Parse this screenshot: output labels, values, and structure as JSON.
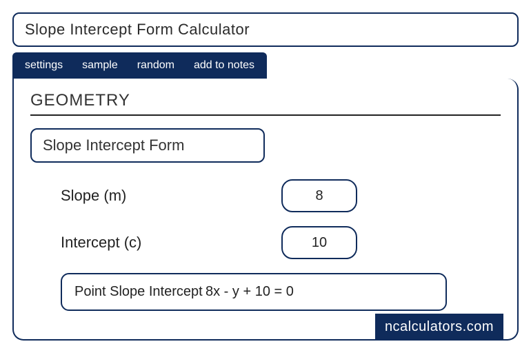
{
  "title": "Slope Intercept Form Calculator",
  "tabs": {
    "settings": "settings",
    "sample": "sample",
    "random": "random",
    "add_to_notes": "add to notes"
  },
  "section_title": "GEOMETRY",
  "form_title": "Slope Intercept Form",
  "fields": {
    "slope": {
      "label": "Slope (m)",
      "value": "8"
    },
    "intercept": {
      "label": "Intercept (c)",
      "value": "10"
    }
  },
  "result": {
    "label": "Point Slope Intercept",
    "value": "8x - y + 10 = 0"
  },
  "brand": "ncalculators.com"
}
